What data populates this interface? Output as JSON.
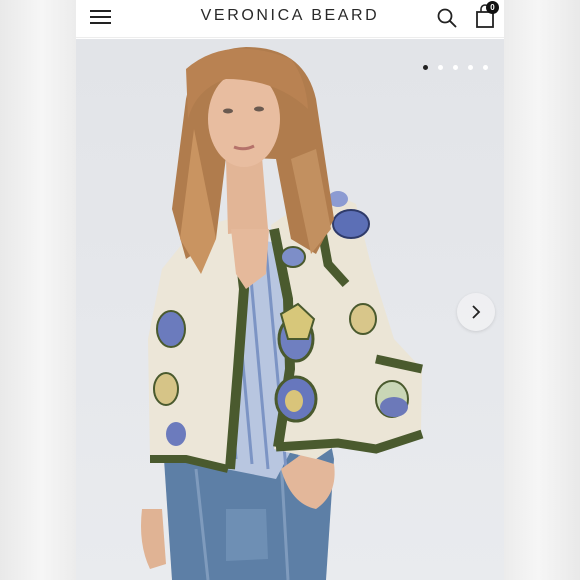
{
  "header": {
    "brand": "VERONICA BEARD",
    "cart_count": "0",
    "icons": [
      "hamburger-menu-icon",
      "search-icon",
      "shopping-bag-icon"
    ]
  },
  "gallery": {
    "image_alt": "Model wearing a cream quilted floral appliqué jacket with green trim over a blue striped shirt and jeans",
    "slide_count": 5,
    "active_slide": 1,
    "next_icon": "chevron-right-icon"
  },
  "colors": {
    "header_bg": "#ffffff",
    "brand_text": "#2a2a2a",
    "badge_bg": "#111111",
    "jacket_trim": "#4a5a2e",
    "backdrop": "#e4e6ea"
  }
}
